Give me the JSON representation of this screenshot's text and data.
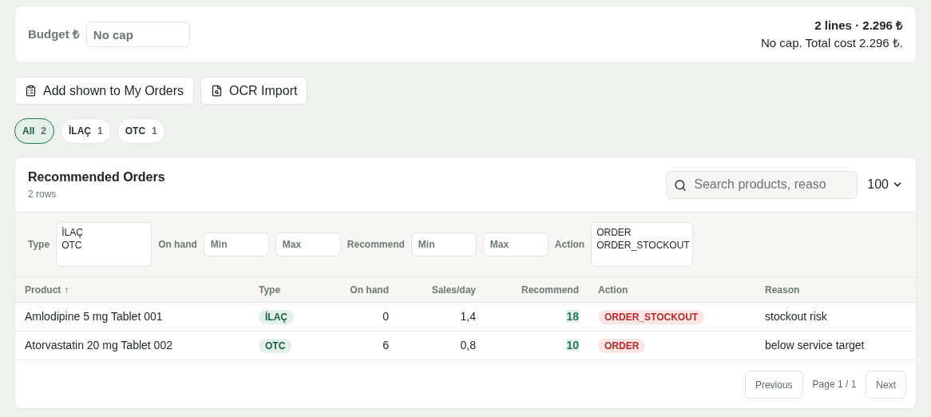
{
  "budget": {
    "label": "Budget ₺",
    "placeholder": "No cap"
  },
  "summary": {
    "headline": "2 lines · 2.296 ₺",
    "detail": "No cap. Total cost 2.296 ₺."
  },
  "actions": [
    {
      "label": "Add shown to My Orders"
    },
    {
      "label": "OCR Import"
    }
  ],
  "chips": [
    {
      "label": "All",
      "count": "2",
      "selected": true
    },
    {
      "label": "İLAÇ",
      "count": "1",
      "selected": false
    },
    {
      "label": "OTC",
      "count": "1",
      "selected": false
    }
  ],
  "panel": {
    "title": "Recommended Orders",
    "subtitle": "2 rows",
    "search_placeholder": "Search products, reaso",
    "page_size": "100"
  },
  "filters": [
    {
      "kind": "list",
      "label": "Type",
      "options": [
        "İLAÇ",
        "OTC"
      ]
    },
    {
      "kind": "range",
      "label": "On hand",
      "min_placeholder": "Min",
      "max_placeholder": "Max"
    },
    {
      "kind": "range",
      "label": "Recommend",
      "min_placeholder": "Min",
      "max_placeholder": "Max"
    },
    {
      "kind": "list",
      "label": "Action",
      "options": [
        "ORDER",
        "ORDER_STOCKOUT"
      ]
    }
  ],
  "table": {
    "columns": [
      {
        "label": "Product",
        "sort": "↑"
      },
      {
        "label": "Type"
      },
      {
        "label": "On hand"
      },
      {
        "label": "Sales/day"
      },
      {
        "label": "Recommend"
      },
      {
        "label": "Action"
      },
      {
        "label": "Reason"
      }
    ],
    "rows": [
      {
        "product": "Amlodipine 5 mg Tablet 001",
        "type": "İLAÇ",
        "on_hand": "0",
        "sales_day": "1,4",
        "recommend": "18",
        "action": "ORDER_STOCKOUT",
        "reason": "stockout risk"
      },
      {
        "product": "Atorvastatin 20 mg Tablet 002",
        "type": "OTC",
        "on_hand": "6",
        "sales_day": "0,8",
        "recommend": "10",
        "action": "ORDER",
        "reason": "below service target"
      }
    ]
  },
  "pagination": {
    "previous": "Previous",
    "page": "Page 1 / 1",
    "next": "Next"
  }
}
